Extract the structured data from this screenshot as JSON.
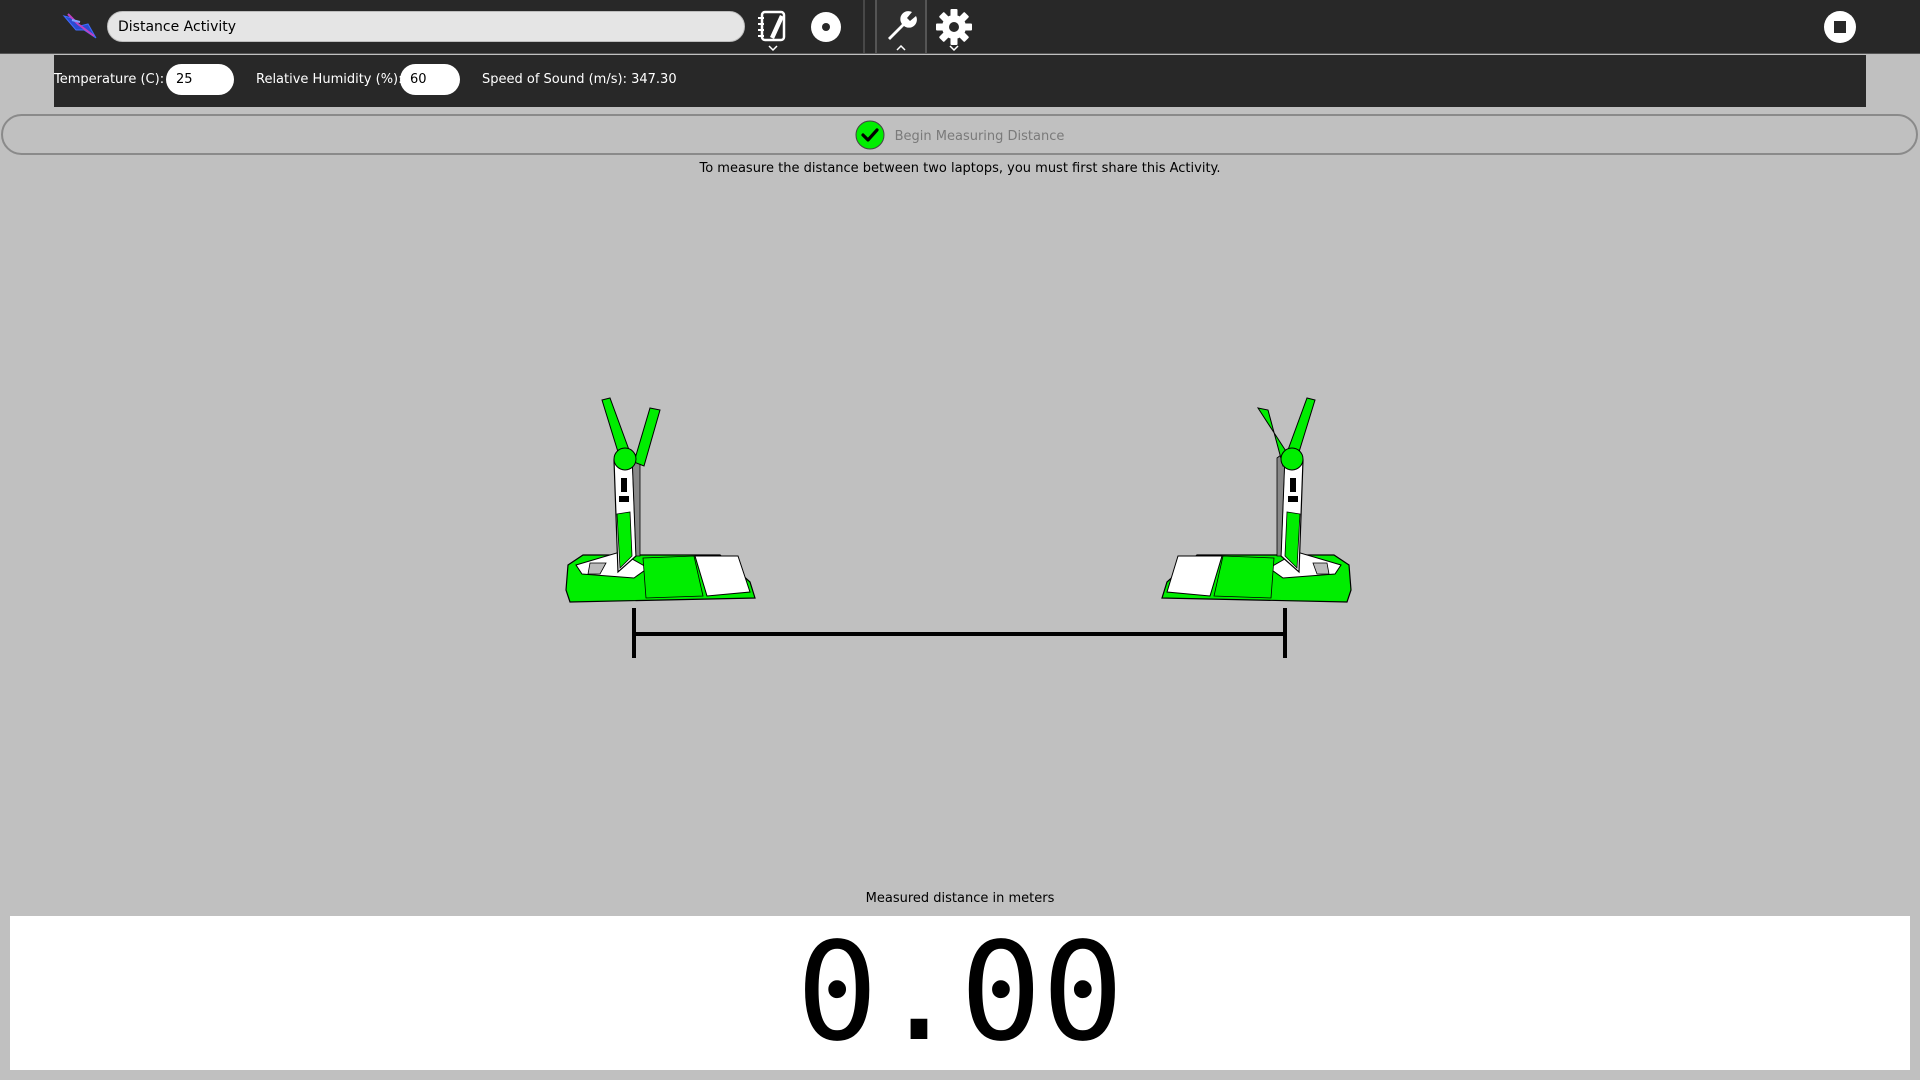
{
  "toolbar": {
    "activity_name": "Distance Activity",
    "icons": [
      "activity-icon",
      "journal-icon",
      "share-icon",
      "tools-icon",
      "settings-icon",
      "stop-icon"
    ]
  },
  "settings": {
    "temperature_label": "Temperature (C):",
    "temperature_value": "25",
    "humidity_label": "Relative Humidity (%):",
    "humidity_value": "60",
    "speed_label": "Speed of Sound (m/s):",
    "speed_value": "347.30"
  },
  "main": {
    "begin_label": "Begin Measuring Distance",
    "instructions": "To measure the distance between two laptops, you must first share this Activity.",
    "measure_caption": "Measured distance in meters",
    "distance_value": "0.00"
  },
  "colors": {
    "laptop_green": "#00ee00",
    "toolbar_bg": "#282828",
    "canvas_bg": "#c0c0c0"
  }
}
